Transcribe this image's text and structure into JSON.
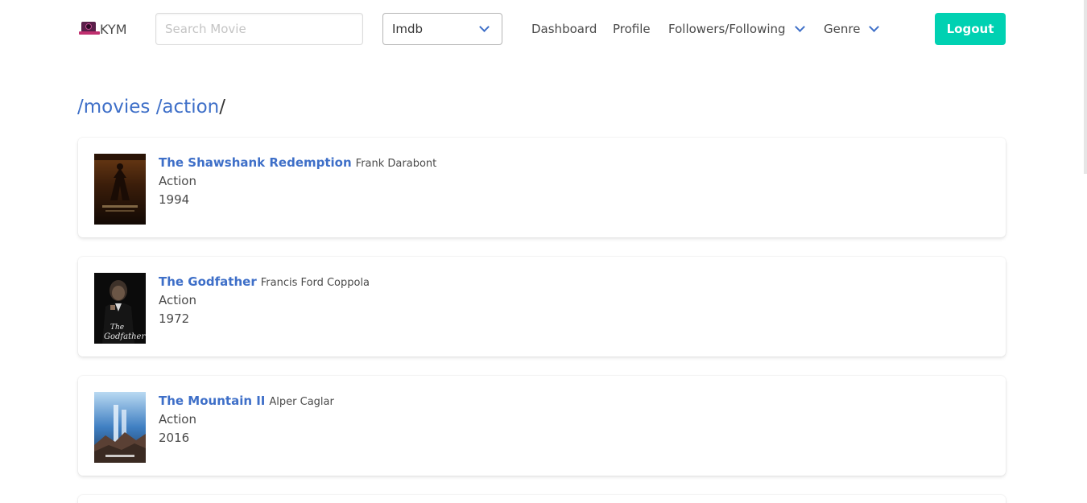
{
  "brand": {
    "name": "KYM"
  },
  "search": {
    "placeholder": "Search Movie",
    "value": ""
  },
  "source_select": {
    "value": "Imdb"
  },
  "nav": {
    "dashboard": "Dashboard",
    "profile": "Profile",
    "followers": "Followers/Following",
    "genre": "Genre"
  },
  "logout_label": "Logout",
  "breadcrumb": {
    "movies": "/movies",
    "action": "/action",
    "trail": "/"
  },
  "movies": [
    {
      "title": "The Shawshank Redemption",
      "director": "Frank Darabont",
      "genre": "Action",
      "year": "1994",
      "poster_icon": "shawshank-poster"
    },
    {
      "title": "The Godfather",
      "director": "Francis Ford Coppola",
      "genre": "Action",
      "year": "1972",
      "poster_icon": "godfather-poster"
    },
    {
      "title": "The Mountain II",
      "director": "Alper Caglar",
      "genre": "Action",
      "year": "2016",
      "poster_icon": "mountain-poster"
    }
  ],
  "colors": {
    "accent": "#3e6fc8",
    "primary_button": "#00d1b2"
  }
}
